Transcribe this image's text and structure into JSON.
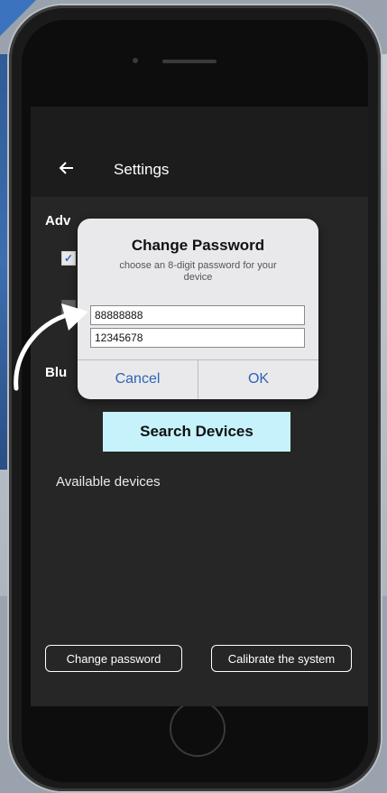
{
  "app": {
    "title": "Settings",
    "section_advanced_partial": "Adv",
    "section_bluetooth_partial": "Blu",
    "search_button": "Search Devices",
    "available_label": "Available devices",
    "change_password_button": "Change password",
    "calibrate_button": "Calibrate the system"
  },
  "dialog": {
    "title": "Change Password",
    "subtitle": "choose an 8-digit password for your device",
    "field1_value": "88888888",
    "field2_value": "12345678",
    "cancel_label": "Cancel",
    "ok_label": "OK"
  },
  "colors": {
    "accent_button": "#c6f2fb",
    "dialog_button_text": "#2d63b7",
    "screen_bg": "#262626"
  },
  "icons": {
    "back": "arrow-left-icon",
    "checkbox": "checkbox-checked-icon",
    "annotation": "curved-arrow-icon"
  }
}
